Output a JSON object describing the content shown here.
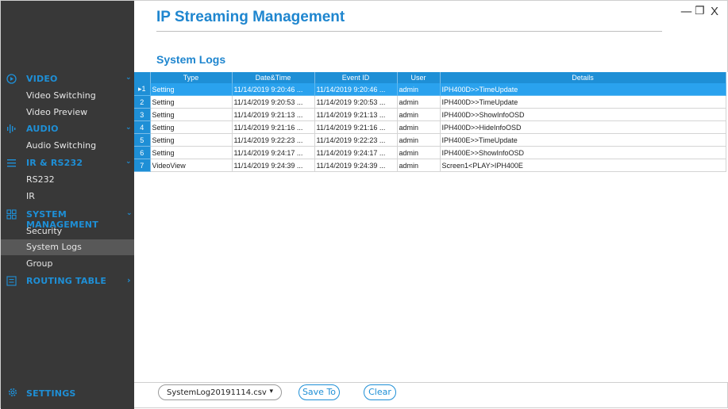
{
  "window": {
    "title": "IP Streaming Management",
    "minimize_glyph": "—",
    "restore_glyph": "❐",
    "close_glyph": "X"
  },
  "sidebar": {
    "video": {
      "label": "VIDEO",
      "icon": "play-circle-icon",
      "items": [
        "Video Switching",
        "Video Preview"
      ]
    },
    "audio": {
      "label": "AUDIO",
      "icon": "audio-wave-icon",
      "items": [
        "Audio Switching"
      ]
    },
    "ir_rs232": {
      "label": "IR & RS232",
      "icon": "list-lines-icon",
      "items": [
        "RS232",
        "IR"
      ]
    },
    "system_management": {
      "label": "SYSTEM MANAGEMENT",
      "icon": "grid-squares-icon",
      "items": [
        "Security",
        "System Logs",
        "Group"
      ],
      "active_item": "System Logs"
    },
    "routing_table": {
      "label": "ROUTING TABLE",
      "icon": "table-icon"
    },
    "settings": {
      "label": "SETTINGS",
      "icon": "gear-icon"
    },
    "accent_color": "#1e8fd6",
    "background_color": "#383838"
  },
  "section_title": "System Logs",
  "table": {
    "columns": [
      "Type",
      "Date&Time",
      "Event ID",
      "User",
      "Details"
    ],
    "selected_row": 1,
    "rows": [
      {
        "num": "1",
        "type": "Setting",
        "datetime": "11/14/2019 9:20:46 ...",
        "event_id": "11/14/2019 9:20:46 ...",
        "user": "admin",
        "details": "IPH400D>>TimeUpdate"
      },
      {
        "num": "2",
        "type": "Setting",
        "datetime": "11/14/2019 9:20:53 ...",
        "event_id": "11/14/2019 9:20:53 ...",
        "user": "admin",
        "details": "IPH400D>>TimeUpdate"
      },
      {
        "num": "3",
        "type": "Setting",
        "datetime": "11/14/2019 9:21:13 ...",
        "event_id": "11/14/2019 9:21:13 ...",
        "user": "admin",
        "details": "IPH400D>>ShowInfoOSD"
      },
      {
        "num": "4",
        "type": "Setting",
        "datetime": "11/14/2019 9:21:16 ...",
        "event_id": "11/14/2019 9:21:16 ...",
        "user": "admin",
        "details": "IPH400D>>HideInfoOSD"
      },
      {
        "num": "5",
        "type": "Setting",
        "datetime": "11/14/2019 9:22:23 ...",
        "event_id": "11/14/2019 9:22:23 ...",
        "user": "admin",
        "details": "IPH400E>>TimeUpdate"
      },
      {
        "num": "6",
        "type": "Setting",
        "datetime": "11/14/2019 9:24:17 ...",
        "event_id": "11/14/2019 9:24:17 ...",
        "user": "admin",
        "details": "IPH400E>>ShowInfoOSD"
      },
      {
        "num": "7",
        "type": "VideoView",
        "datetime": "11/14/2019 9:24:39 ...",
        "event_id": "11/14/2019 9:24:39 ...",
        "user": "admin",
        "details": "Screen1<PLAY>IPH400E"
      }
    ]
  },
  "footer": {
    "file_select_value": "SystemLog20191114.csv",
    "save_label": "Save To",
    "clear_label": "Clear"
  }
}
